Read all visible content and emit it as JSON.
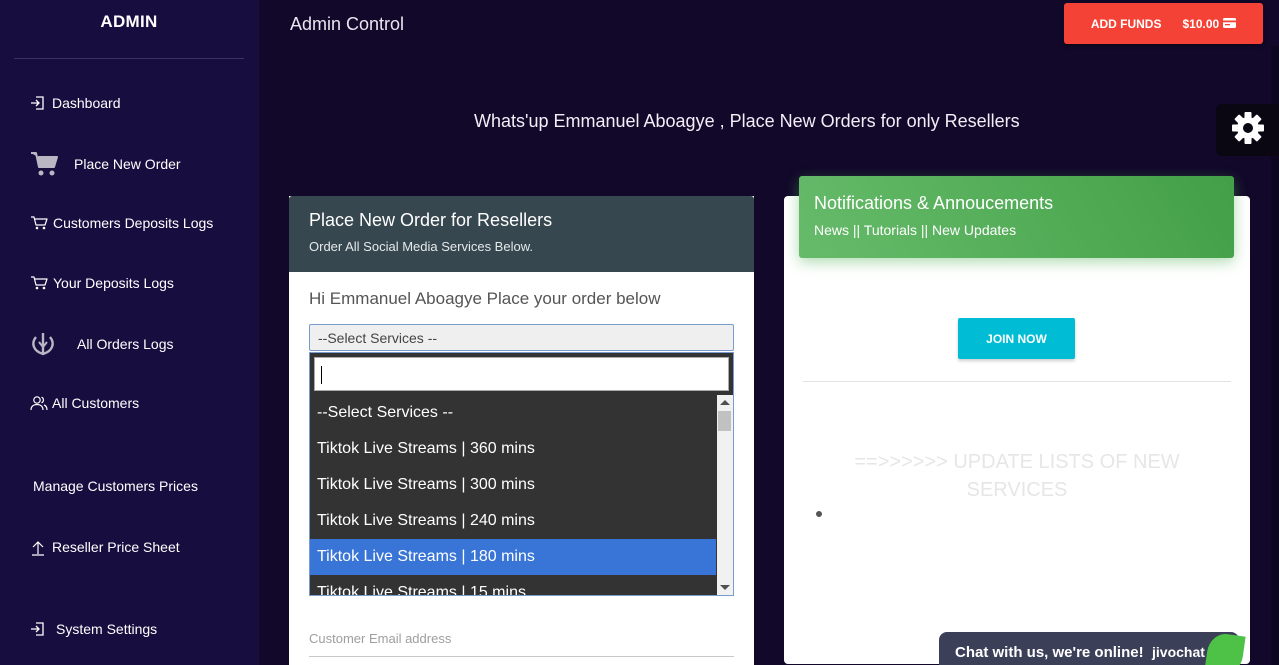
{
  "sidebar": {
    "brand": "ADMIN",
    "items": [
      {
        "label": "Dashboard",
        "icon": "sign-in-icon"
      },
      {
        "label": "Place New Order",
        "icon": "cart-icon"
      },
      {
        "label": "Customers Deposits Logs",
        "icon": "cart-icon"
      },
      {
        "label": "Your Deposits Logs",
        "icon": "cart-icon"
      },
      {
        "label": "All Orders Logs",
        "icon": "rebel-emblem-icon"
      },
      {
        "label": "All Customers",
        "icon": "users-icon"
      },
      {
        "label": "Manage Customers Prices",
        "icon": ""
      },
      {
        "label": "Reseller Price Sheet",
        "icon": "upload-arrow-icon"
      },
      {
        "label": "System Settings",
        "icon": "sign-in-icon"
      }
    ]
  },
  "header": {
    "title": "Admin Control",
    "add_funds_label": "ADD FUNDS",
    "balance": "$10.00",
    "accent": "#f44336"
  },
  "greeting": "Whats'up Emmanuel Aboagye , Place New Orders for only Resellers",
  "order": {
    "title": "Place New Order for Resellers",
    "subtitle": "Order All Social Media Services Below.",
    "intro": "Hi Emmanuel Aboagye Place your order below",
    "select_value": "--Select Services --",
    "search_value": "",
    "options": [
      "--Select Services --",
      "Tiktok Live Streams | 360 mins",
      "Tiktok Live Streams | 300 mins",
      "Tiktok Live Streams | 240 mins",
      "Tiktok Live Streams | 180 mins",
      "Tiktok Live Streams | 15 mins"
    ],
    "highlighted_option_index": 4,
    "email_label": "Customer Email address",
    "header_color": "#37474f"
  },
  "notifications": {
    "title": "Notifications & Annoucements",
    "subtitle": "News || Tutorials || New Updates",
    "join_label": "JOIN NOW",
    "update_heading": "==>>>>>> UPDATE LISTS OF NEW SERVICES",
    "header_color": "#4caf50",
    "join_color": "#00bcd4"
  },
  "chat": {
    "text": "Chat with us, we're online!",
    "brand": "jivochat"
  }
}
